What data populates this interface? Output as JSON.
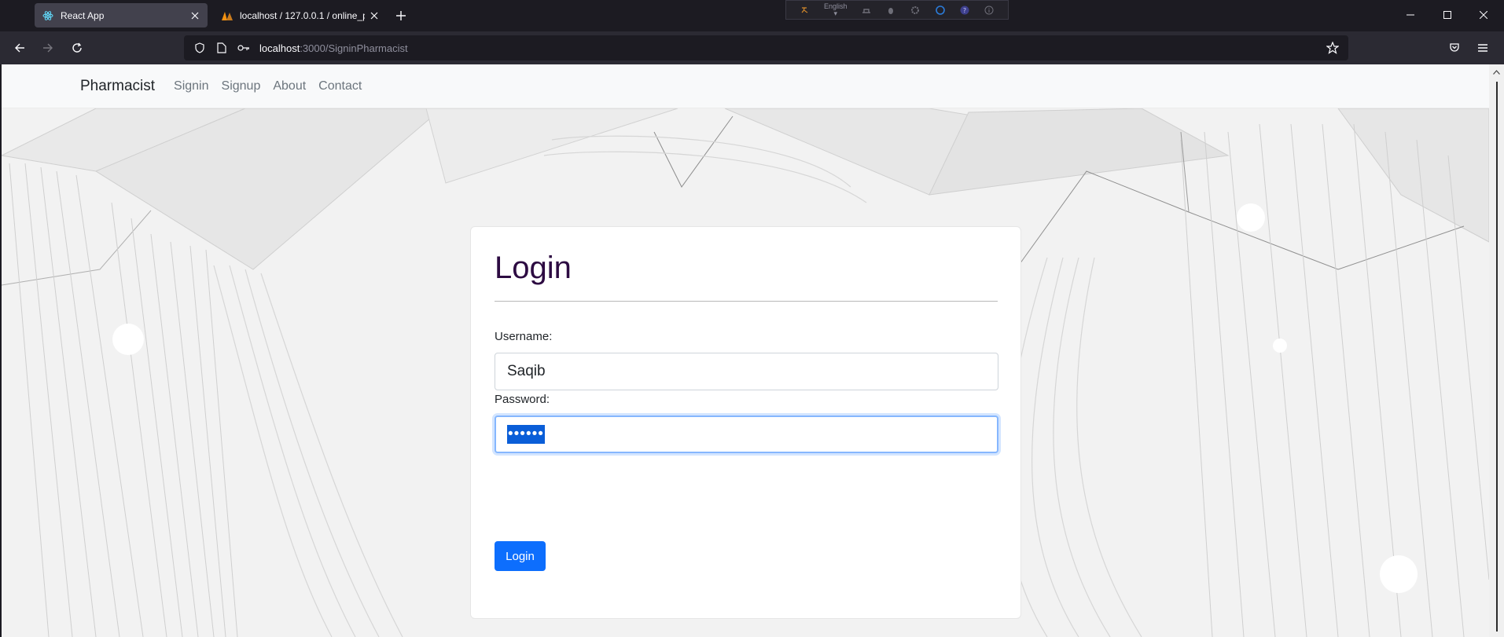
{
  "browser": {
    "tabs": [
      {
        "title": "React App",
        "favicon": "react-icon",
        "active": true
      },
      {
        "title": "localhost / 127.0.0.1 / online_ph",
        "favicon": "phpmyadmin-icon",
        "active": false
      }
    ],
    "extension_language": "English",
    "url_host": "localhost",
    "url_path": ":3000/SigninPharmacist"
  },
  "site": {
    "brand": "Pharmacist",
    "nav": [
      "Signin",
      "Signup",
      "About",
      "Contact"
    ]
  },
  "login": {
    "title": "Login",
    "username_label": "Username:",
    "username_value": "Saqib",
    "password_label": "Password:",
    "password_value": "••••••",
    "button_label": "Login"
  },
  "colors": {
    "primary": "#0d6efd",
    "title": "#2d0b42",
    "chrome_bg": "#1c1b22"
  }
}
